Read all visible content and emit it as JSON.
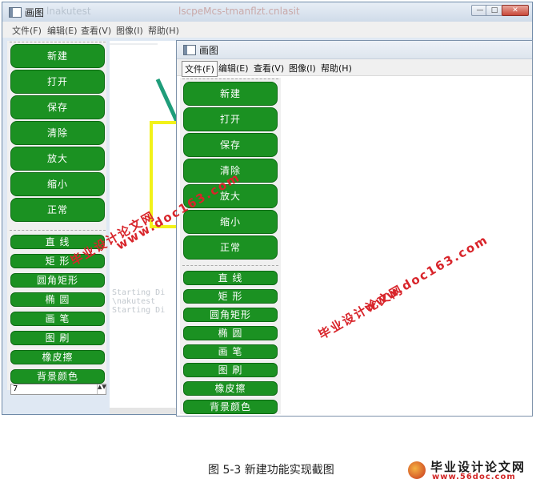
{
  "app_title": "画图",
  "back_window": {
    "title": "画图",
    "title_ghost": "lnakutest",
    "title_ghost2": "lscpeMcs-tmanflzt.cnlasit",
    "window_buttons": {
      "minimize": "—",
      "maximize": "□",
      "close": "✕"
    },
    "menu": [
      "文件(F)",
      "编辑(E)",
      "查看(V)",
      "图像(I)",
      "帮助(H)"
    ],
    "tools_big": [
      "新建",
      "打开",
      "保存",
      "清除",
      "放大",
      "缩小",
      "正常"
    ],
    "tools_small": [
      "直  线",
      "矩  形",
      "圆角矩形",
      "椭  圆",
      "画  笔",
      "图  刷",
      "橡皮擦",
      "背景颜色"
    ],
    "spin_value": "7",
    "spin_arrows": "▲▼"
  },
  "front_window": {
    "title": "画图",
    "menu": [
      "文件(F)",
      "编辑(E)",
      "查看(V)",
      "图像(I)",
      "帮助(H)"
    ],
    "tools_big": [
      "新建",
      "打开",
      "保存",
      "清除",
      "放大",
      "缩小",
      "正常"
    ],
    "tools_small": [
      "直  线",
      "矩  形",
      "圆角矩形",
      "椭  圆",
      "画  笔",
      "图  刷",
      "橡皮擦",
      "背景颜色"
    ]
  },
  "watermarks": {
    "site_cn": "毕业设计论文网",
    "site_url": "www.doc163.com"
  },
  "caption": "图 5-3  新建功能实现截图",
  "logo": {
    "text": "毕业设计论文网",
    "url": "www.56doc.com"
  },
  "colors": {
    "tool_green": "#1b9122",
    "watermark_red": "#d8242a",
    "shape_yellow": "#f2f21a",
    "line_teal": "#1f9d7a"
  }
}
